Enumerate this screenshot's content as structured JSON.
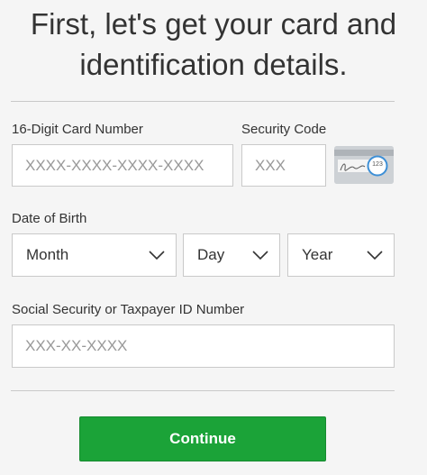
{
  "heading": {
    "line1": "First, let's get your card and",
    "line2": "identification details."
  },
  "card_number": {
    "label": "16-Digit Card Number",
    "placeholder": "XXXX-XXXX-XXXX-XXXX"
  },
  "security_code": {
    "label": "Security Code",
    "placeholder": "XXX",
    "card_hint_number": "123"
  },
  "date_of_birth": {
    "label": "Date of Birth",
    "month": "Month",
    "day": "Day",
    "year": "Year"
  },
  "ssn": {
    "label": "Social Security or Taxpayer ID Number",
    "placeholder": "XXX-XX-XXXX"
  },
  "continue_button": {
    "label": "Continue"
  },
  "colors": {
    "button_green": "#1ba338",
    "background": "#f5f5f5",
    "field_border": "#c9c9c9"
  }
}
